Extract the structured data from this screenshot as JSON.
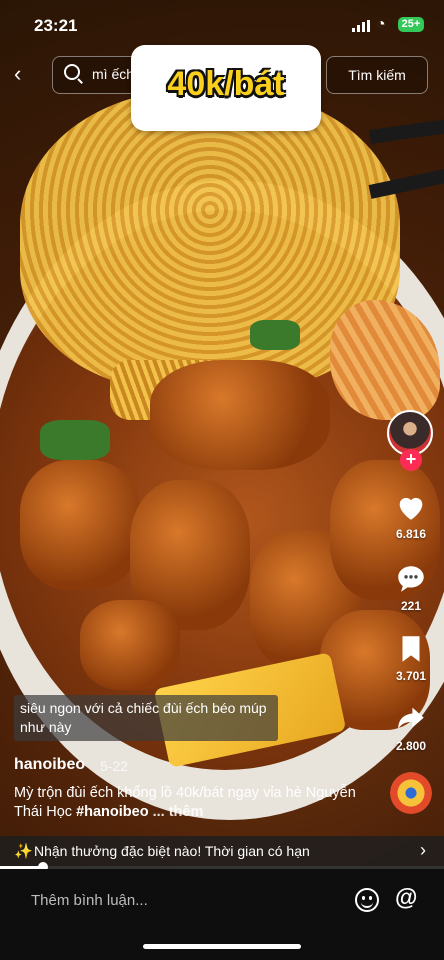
{
  "status_bar": {
    "time": "23:21",
    "battery": "25+"
  },
  "search": {
    "query": "mì ếch",
    "button_label": "Tìm kiếm"
  },
  "sticker": {
    "text": "40k/bát"
  },
  "actions": {
    "likes": "6.816",
    "comments": "221",
    "saves": "3.701",
    "shares": "2.800"
  },
  "caption_overlay": "siêu ngon với cả chiếc đùi ếch béo múp như này",
  "post": {
    "username": "hanoibeo",
    "date": "5-22",
    "description_main": "Mỳ trộn đùi ếch khổng lồ 40k/bát ngay vỉa hè Nguyễn Thái Học ",
    "hashtag": "#hanoibeo",
    "more": "... thêm"
  },
  "promo": {
    "text": "Nhận thưởng đặc biệt nào! Thời gian có hạn"
  },
  "comment": {
    "placeholder": "Thêm bình luận..."
  },
  "colors": {
    "accent": "#fe2c55",
    "sticker_text": "#fbd01c",
    "battery": "#34c759"
  },
  "progress": 0.1
}
